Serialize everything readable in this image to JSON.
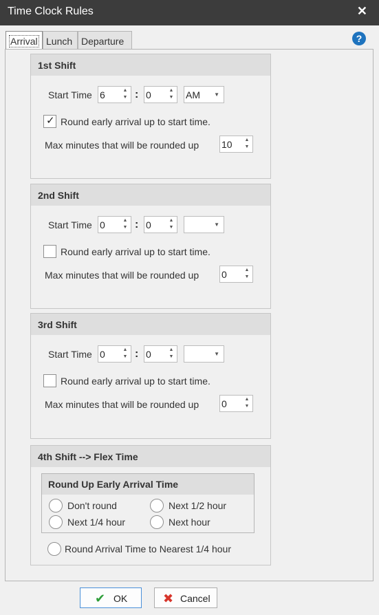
{
  "window": {
    "title": "Time Clock Rules",
    "close_glyph": "✕"
  },
  "help_glyph": "?",
  "tabs": [
    {
      "label": "Arrival",
      "active": true
    },
    {
      "label": "Lunch",
      "active": false
    },
    {
      "label": "Departure",
      "active": false
    }
  ],
  "shifts": [
    {
      "title": "1st Shift",
      "start_time_label": "Start Time",
      "hour": "6",
      "minute": "0",
      "ampm": "AM",
      "round_label": "Round early arrival up to start time.",
      "round_checked": true,
      "max_label": "Max minutes that will be rounded up",
      "max_value": "10"
    },
    {
      "title": "2nd Shift",
      "start_time_label": "Start Time",
      "hour": "0",
      "minute": "0",
      "ampm": "",
      "round_label": "Round early arrival up to start time.",
      "round_checked": false,
      "max_label": "Max minutes that will be rounded up",
      "max_value": "0"
    },
    {
      "title": "3rd Shift",
      "start_time_label": "Start Time",
      "hour": "0",
      "minute": "0",
      "ampm": "",
      "round_label": "Round early arrival up to start time.",
      "round_checked": false,
      "max_label": "Max minutes that will be rounded up",
      "max_value": "0"
    }
  ],
  "flex": {
    "title": "4th Shift --> Flex Time",
    "round_group_title": "Round Up Early Arrival Time",
    "options": {
      "dont_round": "Don't round",
      "next_half": "Next 1/2 hour",
      "next_quarter": "Next 1/4 hour",
      "next_hour": "Next hour"
    },
    "nearest_label": "Round Arrival Time to Nearest 1/4 hour"
  },
  "buttons": {
    "ok": "OK",
    "cancel": "Cancel"
  },
  "glyphs": {
    "colon": ":",
    "check": "✓",
    "spin": "▲▼",
    "dropdown": "▼",
    "ok_icon": "✔",
    "cancel_icon": "✖"
  },
  "colors": {
    "titlebar": "#3c3c3c",
    "help": "#1e73be",
    "ok_icon": "#2e9e3a",
    "cancel_icon": "#d7352b"
  }
}
